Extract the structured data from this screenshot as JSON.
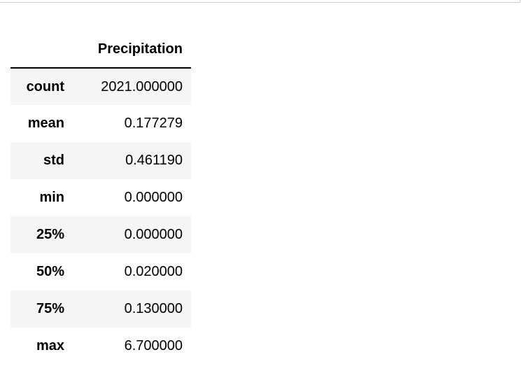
{
  "table": {
    "column_header": "Precipitation",
    "rows": [
      {
        "label": "count",
        "value": "2021.000000"
      },
      {
        "label": "mean",
        "value": "0.177279"
      },
      {
        "label": "std",
        "value": "0.461190"
      },
      {
        "label": "min",
        "value": "0.000000"
      },
      {
        "label": "25%",
        "value": "0.000000"
      },
      {
        "label": "50%",
        "value": "0.020000"
      },
      {
        "label": "75%",
        "value": "0.130000"
      },
      {
        "label": "max",
        "value": "6.700000"
      }
    ]
  }
}
